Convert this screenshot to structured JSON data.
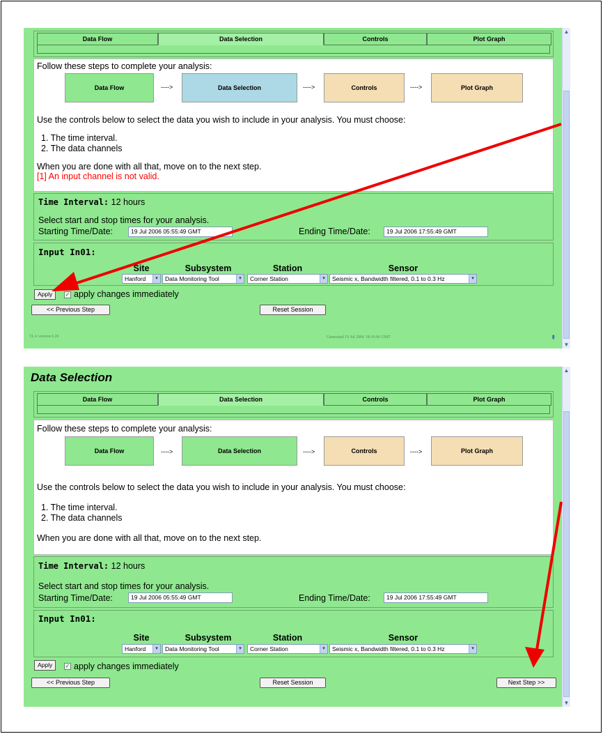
{
  "tabs": [
    "Data Flow",
    "Data Selection",
    "Controls",
    "Plot Graph"
  ],
  "intro": "Follow these steps to complete your analysis:",
  "steps": [
    "Data Flow",
    "Data Selection",
    "Controls",
    "Plot Graph"
  ],
  "step_arrow": "---->",
  "instructions": "Use the controls below to select the data you wish to include in your analysis. You must choose:",
  "list": [
    "1.  The time interval.",
    "2.  The data channels"
  ],
  "done_text": "When you are done with all that, move on to the next step.",
  "error_text": "[1] An input channel is not valid.",
  "time_interval": {
    "label": "Time Interval:",
    "value": "12 hours",
    "hint": "Select start and stop times for your analysis.",
    "start_label": "Starting Time/Date:",
    "start_value": "19 Jul 2006 05:55:49 GMT",
    "end_label": "Ending Time/Date:",
    "end_value": "19 Jul 2006 17:55:49 GMT"
  },
  "input": {
    "title": "Input In01:",
    "columns": [
      "Site",
      "Subsystem",
      "Station",
      "Sensor"
    ],
    "site": "Hanford",
    "subsystem": "Data Monitoring Tool",
    "station": "Corner Station",
    "sensor": "Seismic x, Bandwidth filtered, 0.1 to 0.3 Hz"
  },
  "apply_label": "Apply",
  "apply_immediately": "apply changes immediately",
  "prev_step": "<< Previous Step",
  "reset_session": "Reset Session",
  "next_step": "Next Step >>",
  "page_heading": "Data Selection",
  "footer_version": "TLA version 0.20",
  "footer_center": "Generated 19 Jul 2006 18:16:06 GMT",
  "colors": {
    "panel_green": "#8fe88f",
    "current_step_blue": "#add8e6",
    "future_step_tan": "#f5deb3",
    "error_red": "#ff0000",
    "annotation_arrow": "#ee0000"
  },
  "icons": [
    "checkbox-checked-icon",
    "dropdown-arrow-icon",
    "scroll-up-icon",
    "scroll-down-icon"
  ]
}
